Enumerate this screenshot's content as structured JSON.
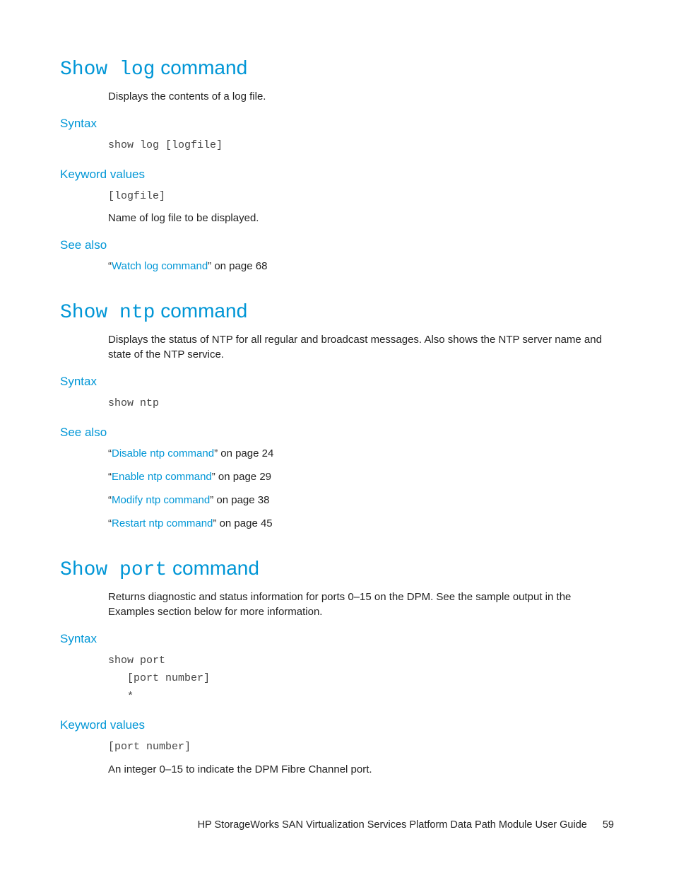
{
  "sections": [
    {
      "id": "show-log",
      "heading_mono": "Show log",
      "heading_sans": " command",
      "desc": "Displays the contents of a log file.",
      "blocks": [
        {
          "type": "sub",
          "label": "Syntax"
        },
        {
          "type": "mono",
          "text": "show log [logfile]"
        },
        {
          "type": "sub",
          "label": "Keyword values"
        },
        {
          "type": "mono",
          "text": "[logfile]"
        },
        {
          "type": "body",
          "text": "Name of log file to be displayed."
        },
        {
          "type": "sub",
          "label": "See also"
        },
        {
          "type": "see",
          "prefix": "“",
          "link": "Watch log command",
          "suffix": "” on page 68"
        }
      ]
    },
    {
      "id": "show-ntp",
      "heading_mono": "Show ntp",
      "heading_sans": " command",
      "desc": "Displays the status of NTP for all regular and broadcast messages. Also shows the NTP server name and state of the NTP service.",
      "blocks": [
        {
          "type": "sub",
          "label": "Syntax"
        },
        {
          "type": "mono",
          "text": "show ntp"
        },
        {
          "type": "sub",
          "label": "See also"
        },
        {
          "type": "see",
          "prefix": "“",
          "link": "Disable ntp command",
          "suffix": "” on page 24"
        },
        {
          "type": "see",
          "prefix": "“",
          "link": "Enable ntp command",
          "suffix": "” on page 29"
        },
        {
          "type": "see",
          "prefix": "“",
          "link": "Modify ntp command",
          "suffix": "” on page 38"
        },
        {
          "type": "see",
          "prefix": "“",
          "link": "Restart ntp command",
          "suffix": "” on page 45"
        }
      ]
    },
    {
      "id": "show-port",
      "heading_mono": "Show port",
      "heading_sans": " command",
      "desc": "Returns diagnostic and status information for ports 0–15 on the DPM. See the sample output in the Examples section below for more information.",
      "blocks": [
        {
          "type": "sub",
          "label": "Syntax"
        },
        {
          "type": "mono",
          "text": "show port\n   [port number]\n   *"
        },
        {
          "type": "sub",
          "label": "Keyword values"
        },
        {
          "type": "mono",
          "text": "[port number]"
        },
        {
          "type": "body",
          "text": "An integer 0–15 to indicate the DPM Fibre Channel port."
        }
      ]
    }
  ],
  "footer": {
    "title": "HP StorageWorks SAN Virtualization Services Platform Data Path Module User Guide",
    "page": "59"
  }
}
